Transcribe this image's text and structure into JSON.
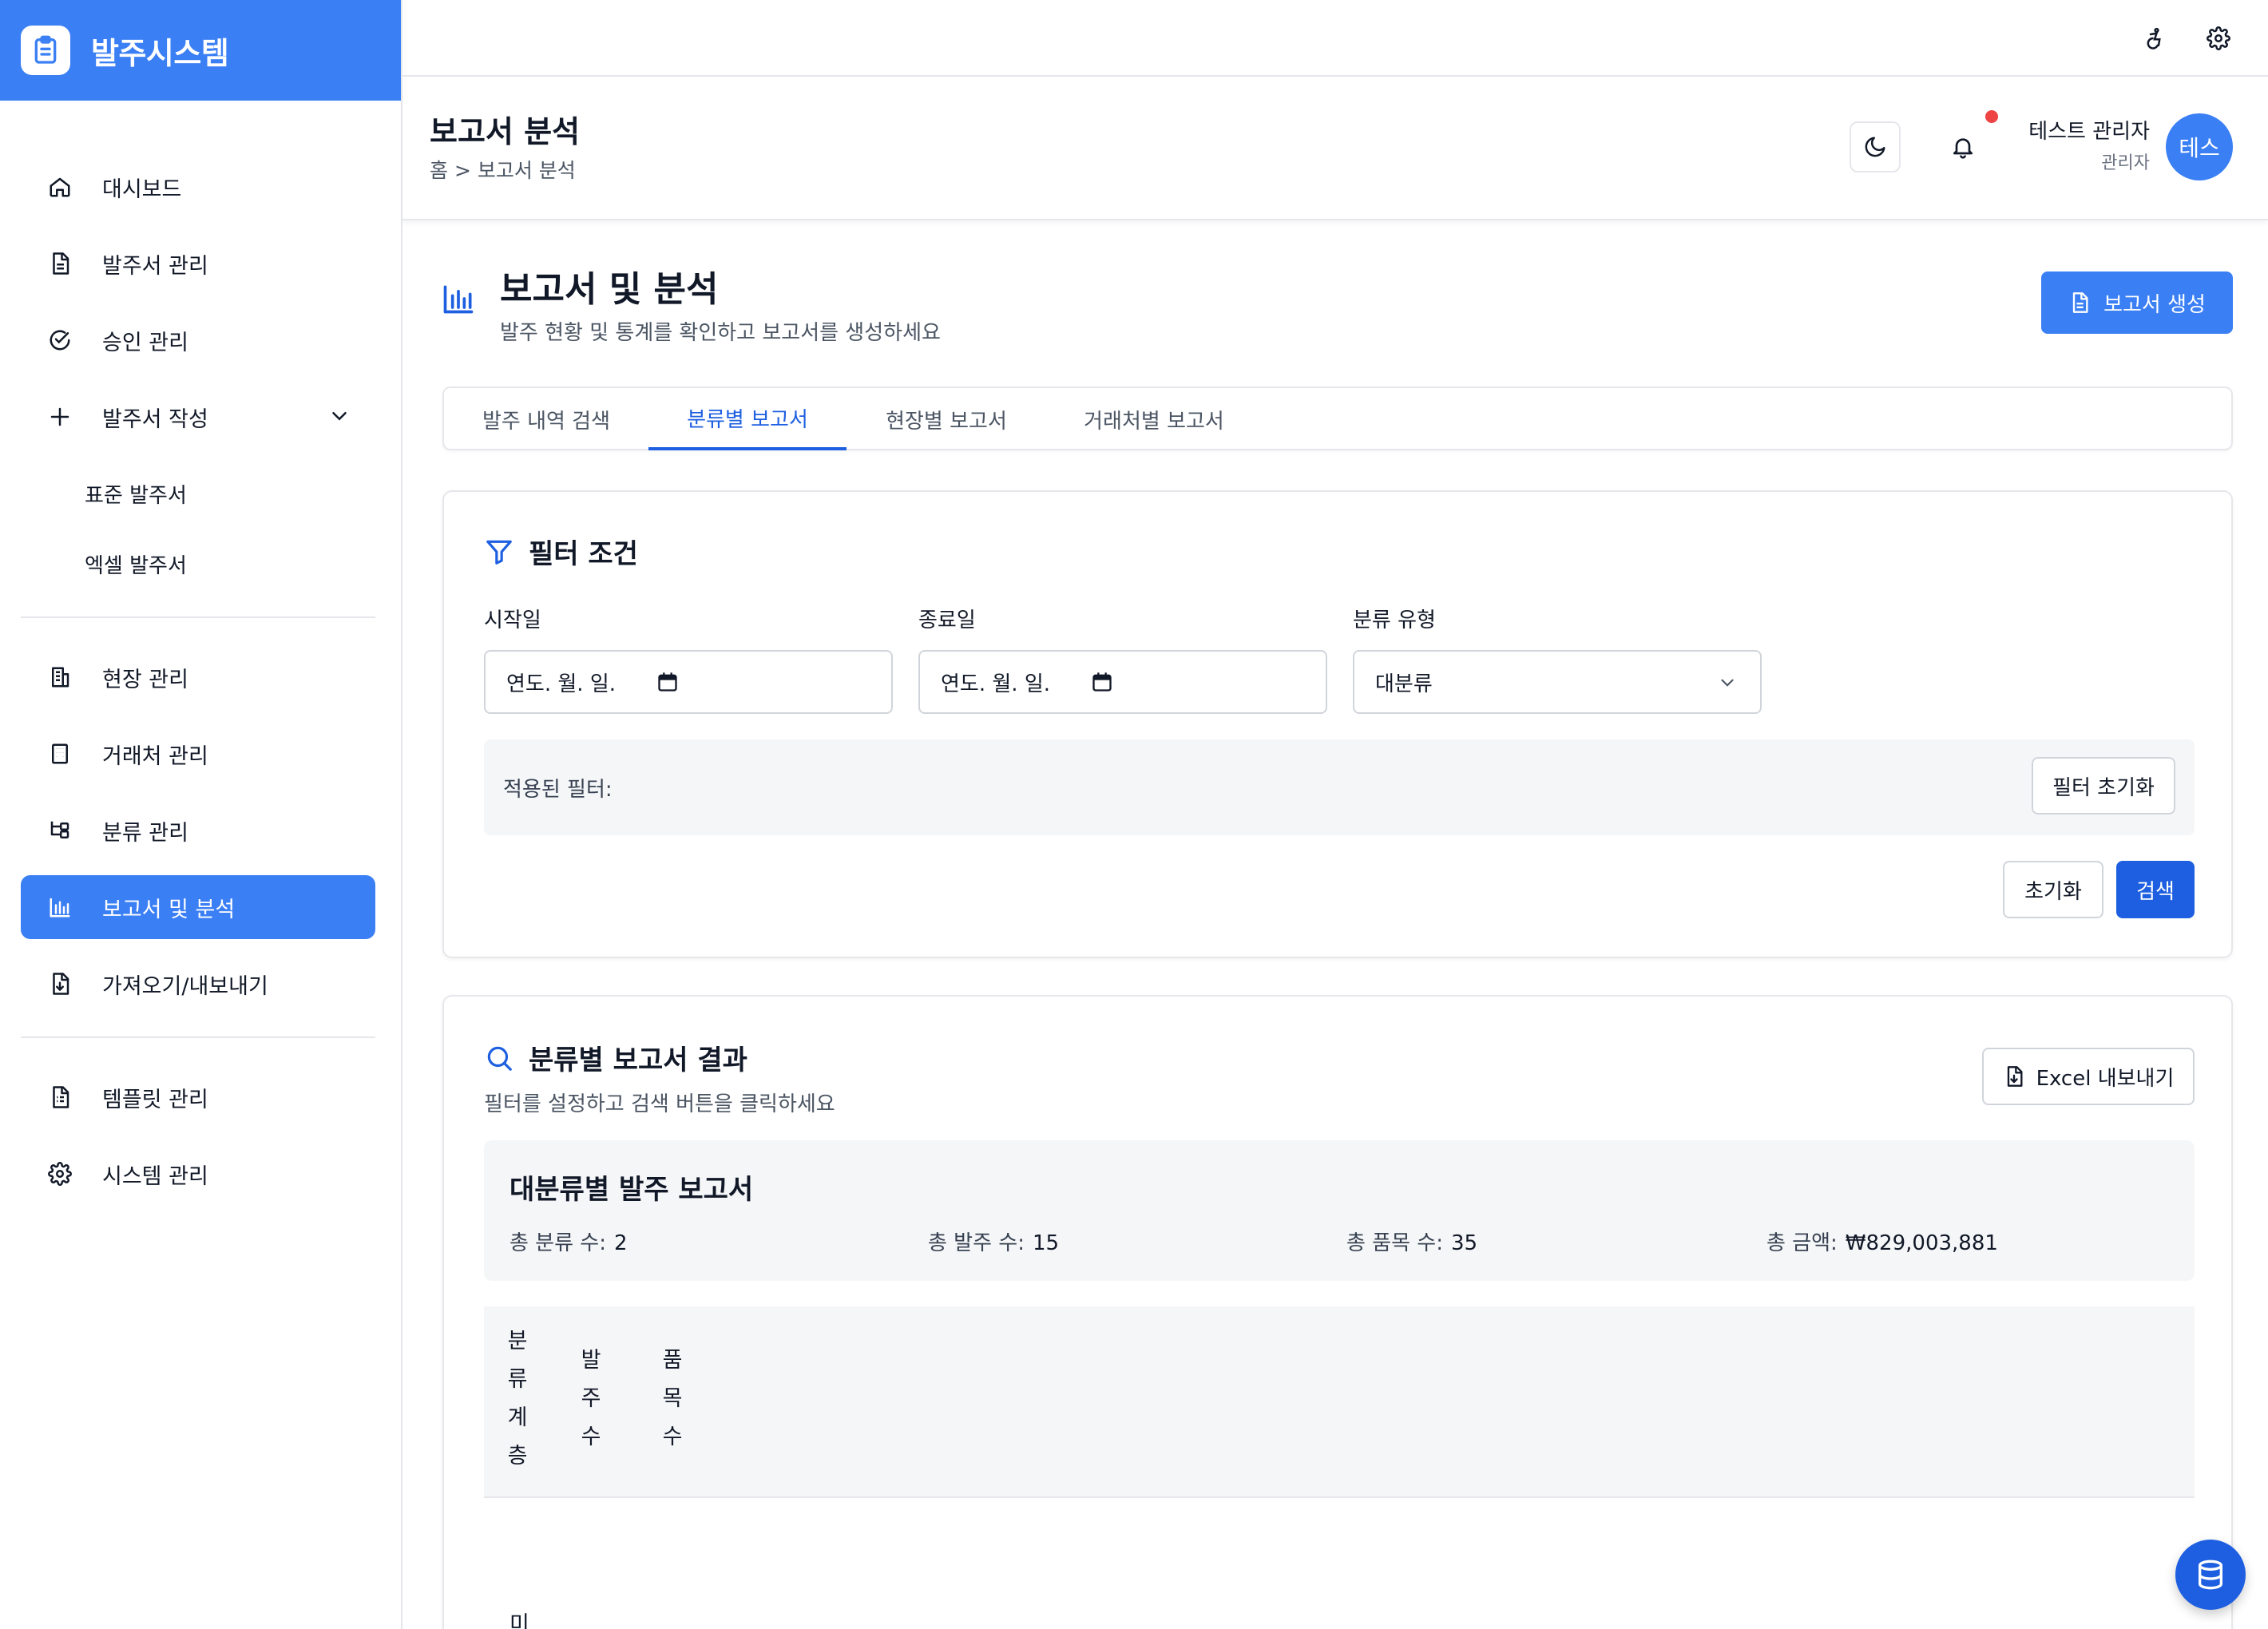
{
  "app": {
    "title": "발주시스템"
  },
  "sidebar": {
    "items": [
      {
        "label": "대시보드",
        "icon": "home-icon"
      },
      {
        "label": "발주서 관리",
        "icon": "document-icon"
      },
      {
        "label": "승인 관리",
        "icon": "check-circle-icon"
      },
      {
        "label": "발주서 작성",
        "icon": "plus-icon"
      },
      {
        "label": "현장 관리",
        "icon": "building-icon"
      },
      {
        "label": "거래처 관리",
        "icon": "office-icon"
      },
      {
        "label": "분류 관리",
        "icon": "hierarchy-icon"
      },
      {
        "label": "보고서 및 분석",
        "icon": "bar-chart-icon"
      },
      {
        "label": "가져오기/내보내기",
        "icon": "file-download-icon"
      },
      {
        "label": "템플릿 관리",
        "icon": "template-icon"
      },
      {
        "label": "시스템 관리",
        "icon": "gear-icon"
      }
    ],
    "sub_items": [
      "표준 발주서",
      "엑셀 발주서"
    ]
  },
  "header": {
    "title": "보고서 분석",
    "breadcrumb": "홈 > 보고서 분석",
    "user_name": "테스트 관리자",
    "user_role": "관리자",
    "avatar_text": "테스"
  },
  "main": {
    "title": "보고서 및 분석",
    "subtitle": "발주 현황 및 통계를 확인하고 보고서를 생성하세요",
    "create_report_label": "보고서 생성",
    "tabs": [
      "발주 내역 검색",
      "분류별 보고서",
      "현장별 보고서",
      "거래처별 보고서"
    ]
  },
  "filter": {
    "title": "필터 조건",
    "start_label": "시작일",
    "start_value": "연도. 월. 일.",
    "end_label": "종료일",
    "end_value": "연도. 월. 일.",
    "type_label": "분류 유형",
    "type_value": "대분류",
    "applied_label": "적용된 필터:",
    "reset_filter_label": "필터 초기화",
    "reset_label": "초기화",
    "search_label": "검색"
  },
  "result": {
    "title": "분류별 보고서 결과",
    "subtitle": "필터를 설정하고 검색 버튼을 클릭하세요",
    "export_label": "Excel 내보내기",
    "summary_title": "대분류별 발주 보고서",
    "stats": [
      {
        "label": "총 분류 수:",
        "value": "2"
      },
      {
        "label": "총 발주 수:",
        "value": "15"
      },
      {
        "label": "총 품목 수:",
        "value": "35"
      },
      {
        "label": "총 금액:",
        "value": "₩829,003,881"
      }
    ],
    "columns": [
      "분\n류\n계\n층",
      "발\n주\n수",
      "품\n목\n수"
    ],
    "first_row_cell": "미"
  },
  "colors": {
    "brand": "#3b7ff5",
    "primary_dark": "#1d5fe0",
    "notification": "#ef4444"
  }
}
